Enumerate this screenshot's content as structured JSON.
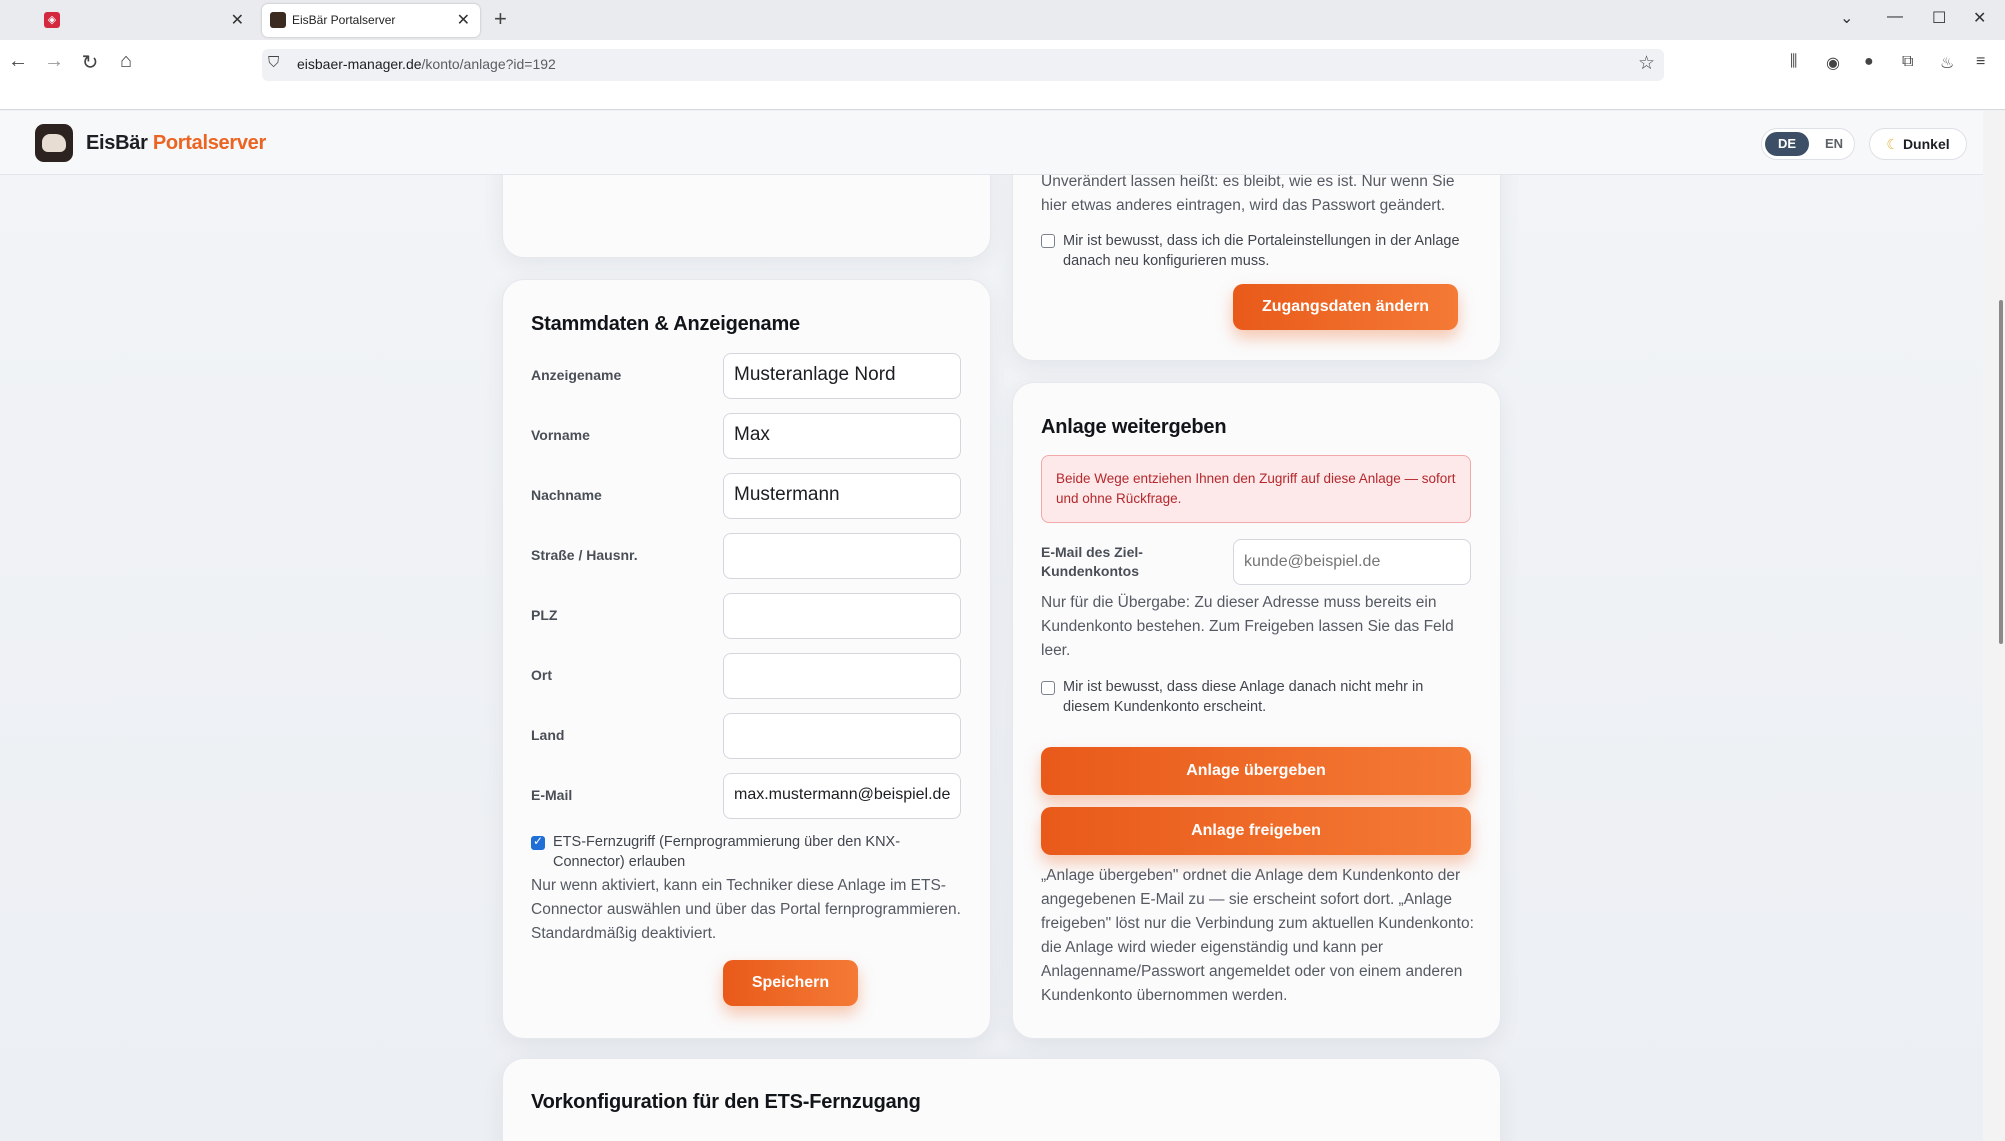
{
  "browser": {
    "tabs": [
      {
        "title": ""
      },
      {
        "title": "EisBär Portalserver"
      }
    ],
    "url_domain": "eisbaer-manager.de",
    "url_path": "/konto/anlage?id=192"
  },
  "header": {
    "brand_main": "EisBär",
    "brand_accent": "Portalserver",
    "lang_de": "DE",
    "lang_en": "EN",
    "theme_label": "Dunkel"
  },
  "credentials_card": {
    "hint_text": "Unverändert lassen heißt: es bleibt, wie es ist. Nur wenn Sie hier etwas anderes eintragen, wird das Passwort geändert.",
    "confirm_text": "Mir ist bewusst, dass ich die Portaleinstellungen in der Anlage danach neu konfigurieren muss.",
    "button_label": "Zugangsdaten ändern"
  },
  "master_data": {
    "title": "Stammdaten & Anzeigename",
    "fields": [
      {
        "label": "Anzeigename",
        "value": "Musteranlage Nord"
      },
      {
        "label": "Vorname",
        "value": "Max"
      },
      {
        "label": "Nachname",
        "value": "Mustermann"
      },
      {
        "label": "Straße / Hausnr.",
        "value": ""
      },
      {
        "label": "PLZ",
        "value": ""
      },
      {
        "label": "Ort",
        "value": ""
      },
      {
        "label": "Land",
        "value": ""
      },
      {
        "label": "E-Mail",
        "value": "max.mustermann@beispiel.de"
      }
    ],
    "ets_checkbox_label": "ETS-Fernzugriff (Fernprogrammierung über den KNX-Connector) erlauben",
    "ets_checked": true,
    "ets_hint": "Nur wenn aktiviert, kann ein Techniker diese Anlage im ETS-Connector auswählen und über das Portal fernprogrammieren. Standardmäßig deaktiviert.",
    "save_label": "Speichern"
  },
  "transfer": {
    "title": "Anlage weitergeben",
    "alert": "Beide Wege entziehen Ihnen den Zugriff auf diese Anlage — sofort und ohne Rückfrage.",
    "email_label": "E-Mail des Ziel-Kundenkontos",
    "email_placeholder": "kunde@beispiel.de",
    "email_hint": "Nur für die Übergabe: Zu dieser Adresse muss bereits ein Kundenkonto bestehen. Zum Freigeben lassen Sie das Feld leer.",
    "confirm_text": "Mir ist bewusst, dass diese Anlage danach nicht mehr in diesem Kundenkonto erscheint.",
    "handover_label": "Anlage übergeben",
    "release_label": "Anlage freigeben",
    "explanation": "„Anlage übergeben\" ordnet die Anlage dem Kundenkonto der angegebenen E-Mail zu — sie erscheint sofort dort. „Anlage freigeben\" löst nur die Verbindung zum aktuellen Kundenkonto: die Anlage wird wieder eigenständig und kann per Anlagenname/Passwort angemeldet oder von einem anderen Kundenkonto übernommen werden."
  },
  "ets_section": {
    "title": "Vorkonfiguration für den ETS-Fernzugang"
  },
  "colors": {
    "accent": "#ec6422",
    "lang_active": "#3c4f66",
    "alert_text": "#b4282d",
    "alert_bg": "#fde9e9"
  }
}
